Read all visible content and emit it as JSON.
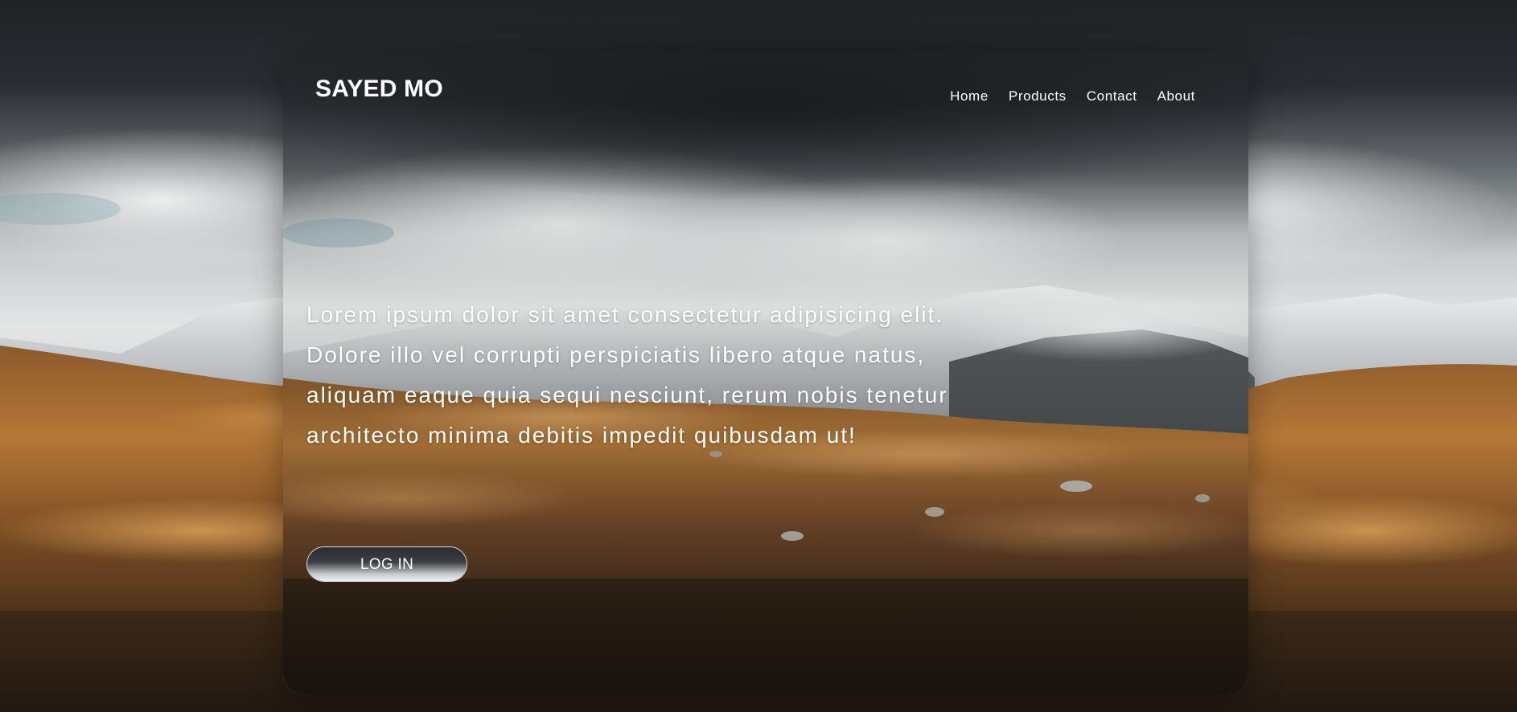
{
  "brand": {
    "name": "SAYED MO"
  },
  "nav": {
    "items": [
      {
        "label": "Home"
      },
      {
        "label": "Products"
      },
      {
        "label": "Contact"
      },
      {
        "label": "About"
      }
    ]
  },
  "hero": {
    "text": "Lorem ipsum dolor sit amet consectetur adipisicing elit. Dolore illo vel corrupti perspiciatis libero atque natus, aliquam eaque quia sequi nesciunt, rerum nobis tenetur architecto minima debitis impedit quibusdam ut!"
  },
  "actions": {
    "login_label": "LOG IN"
  },
  "colors": {
    "sky_dark": "#22242a",
    "cloud": "#e6e8e8",
    "snow": "#d8dadb",
    "hills": "#a86a30",
    "ground_dark": "#2a1f14",
    "text": "#ffffff"
  }
}
